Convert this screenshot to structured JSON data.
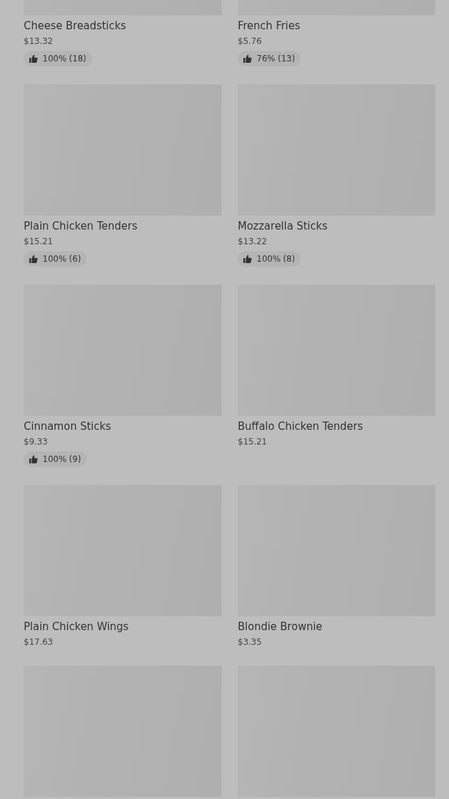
{
  "items": [
    {
      "kind": "dish",
      "name": "Cheese Breadsticks",
      "price": "$13.32",
      "rating": "100% (18)"
    },
    {
      "kind": "dish",
      "name": "French Fries",
      "price": "$5.76",
      "rating": "76% (13)"
    },
    {
      "kind": "dish",
      "name": "Plain Chicken Tenders",
      "price": "$15.21",
      "rating": "100% (6)"
    },
    {
      "kind": "dish",
      "name": "Mozzarella Sticks",
      "price": "$13.22",
      "rating": "100% (8)"
    },
    {
      "kind": "dish",
      "name": "Cinnamon Sticks",
      "price": "$9.33",
      "rating": "100% (9)"
    },
    {
      "kind": "dish",
      "name": "Buffalo Chicken Tenders",
      "price": "$15.21"
    },
    {
      "kind": "dish",
      "name": "Plain Chicken Wings",
      "price": "$17.63"
    },
    {
      "kind": "dish",
      "name": "Blondie Brownie",
      "price": "$3.35"
    },
    {
      "kind": "image-only"
    },
    {
      "kind": "image-only"
    }
  ]
}
